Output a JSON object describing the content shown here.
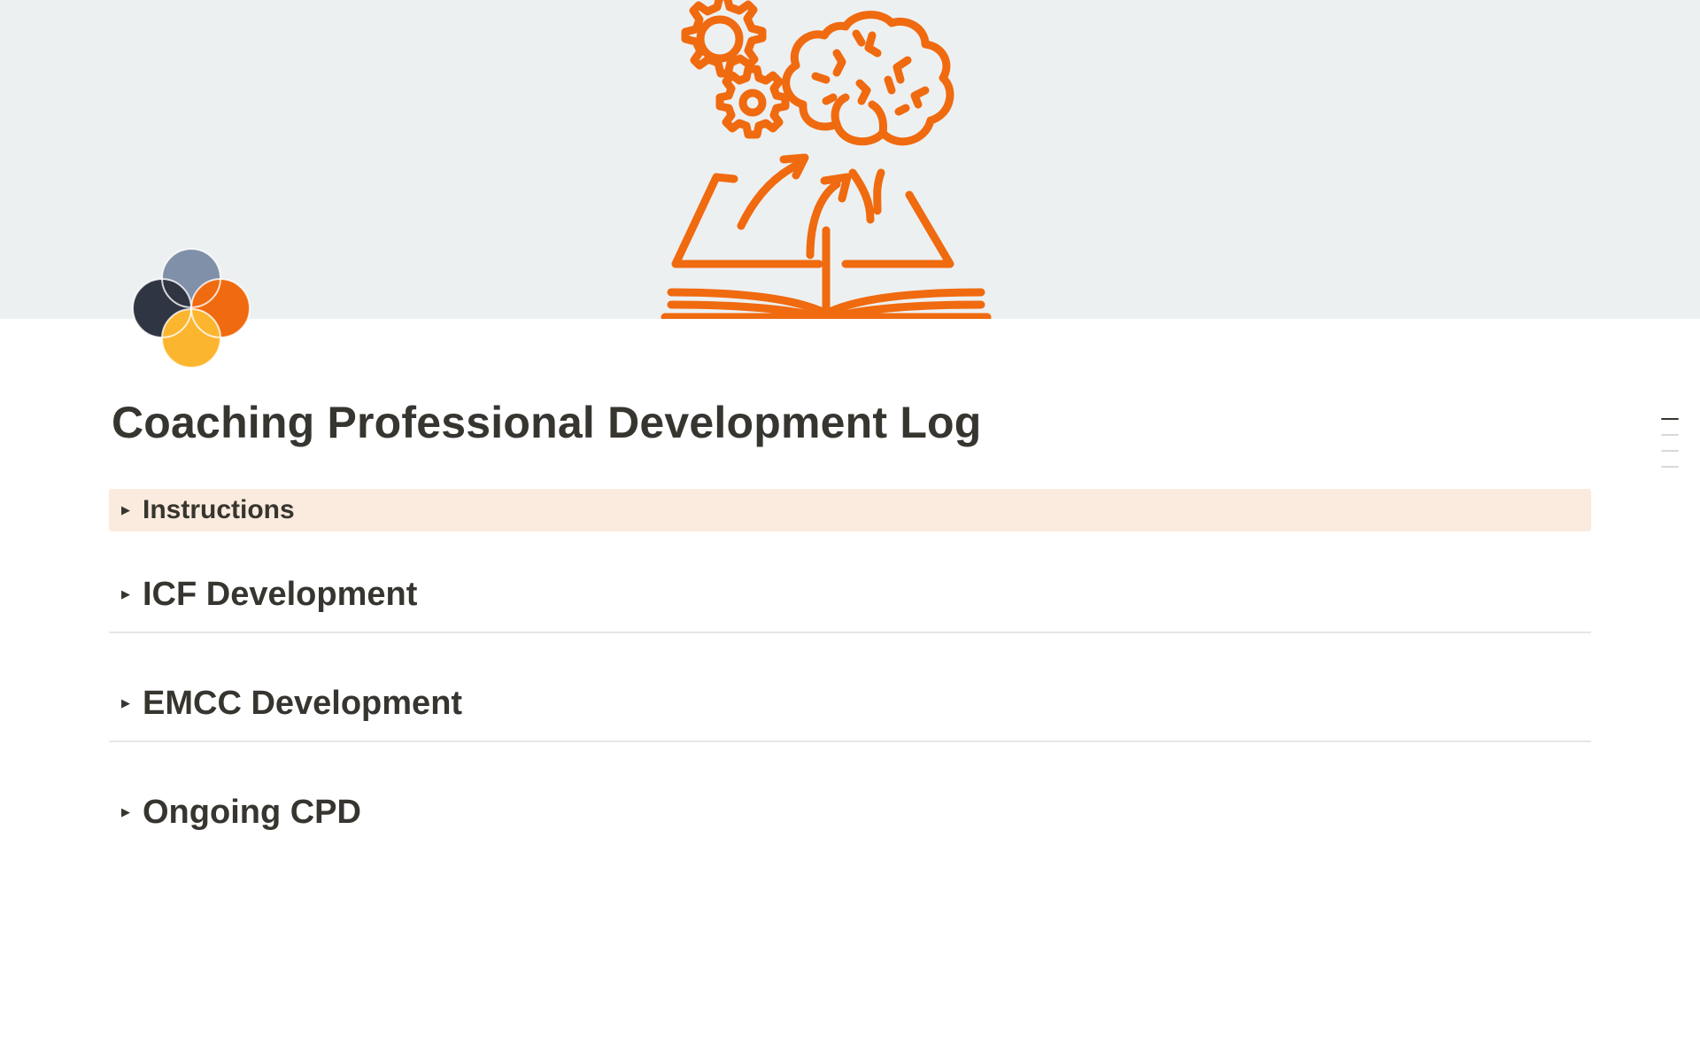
{
  "page": {
    "title": "Coaching Professional Development Log"
  },
  "cover": {
    "background": "#edf0f1",
    "illustration": "book-brain-gears-illustration",
    "accent": "#f06a0f"
  },
  "icon": {
    "name": "four-circles-logo",
    "colors": [
      "#8090a8",
      "#2f3542",
      "#f06a0f",
      "#fcb52f"
    ]
  },
  "callout": {
    "label": "Instructions",
    "background": "#fbebde"
  },
  "sections": [
    {
      "label": "ICF Development"
    },
    {
      "label": "EMCC Development"
    },
    {
      "label": "Ongoing CPD"
    }
  ],
  "toc": {
    "items": 4,
    "active_index": 0
  }
}
